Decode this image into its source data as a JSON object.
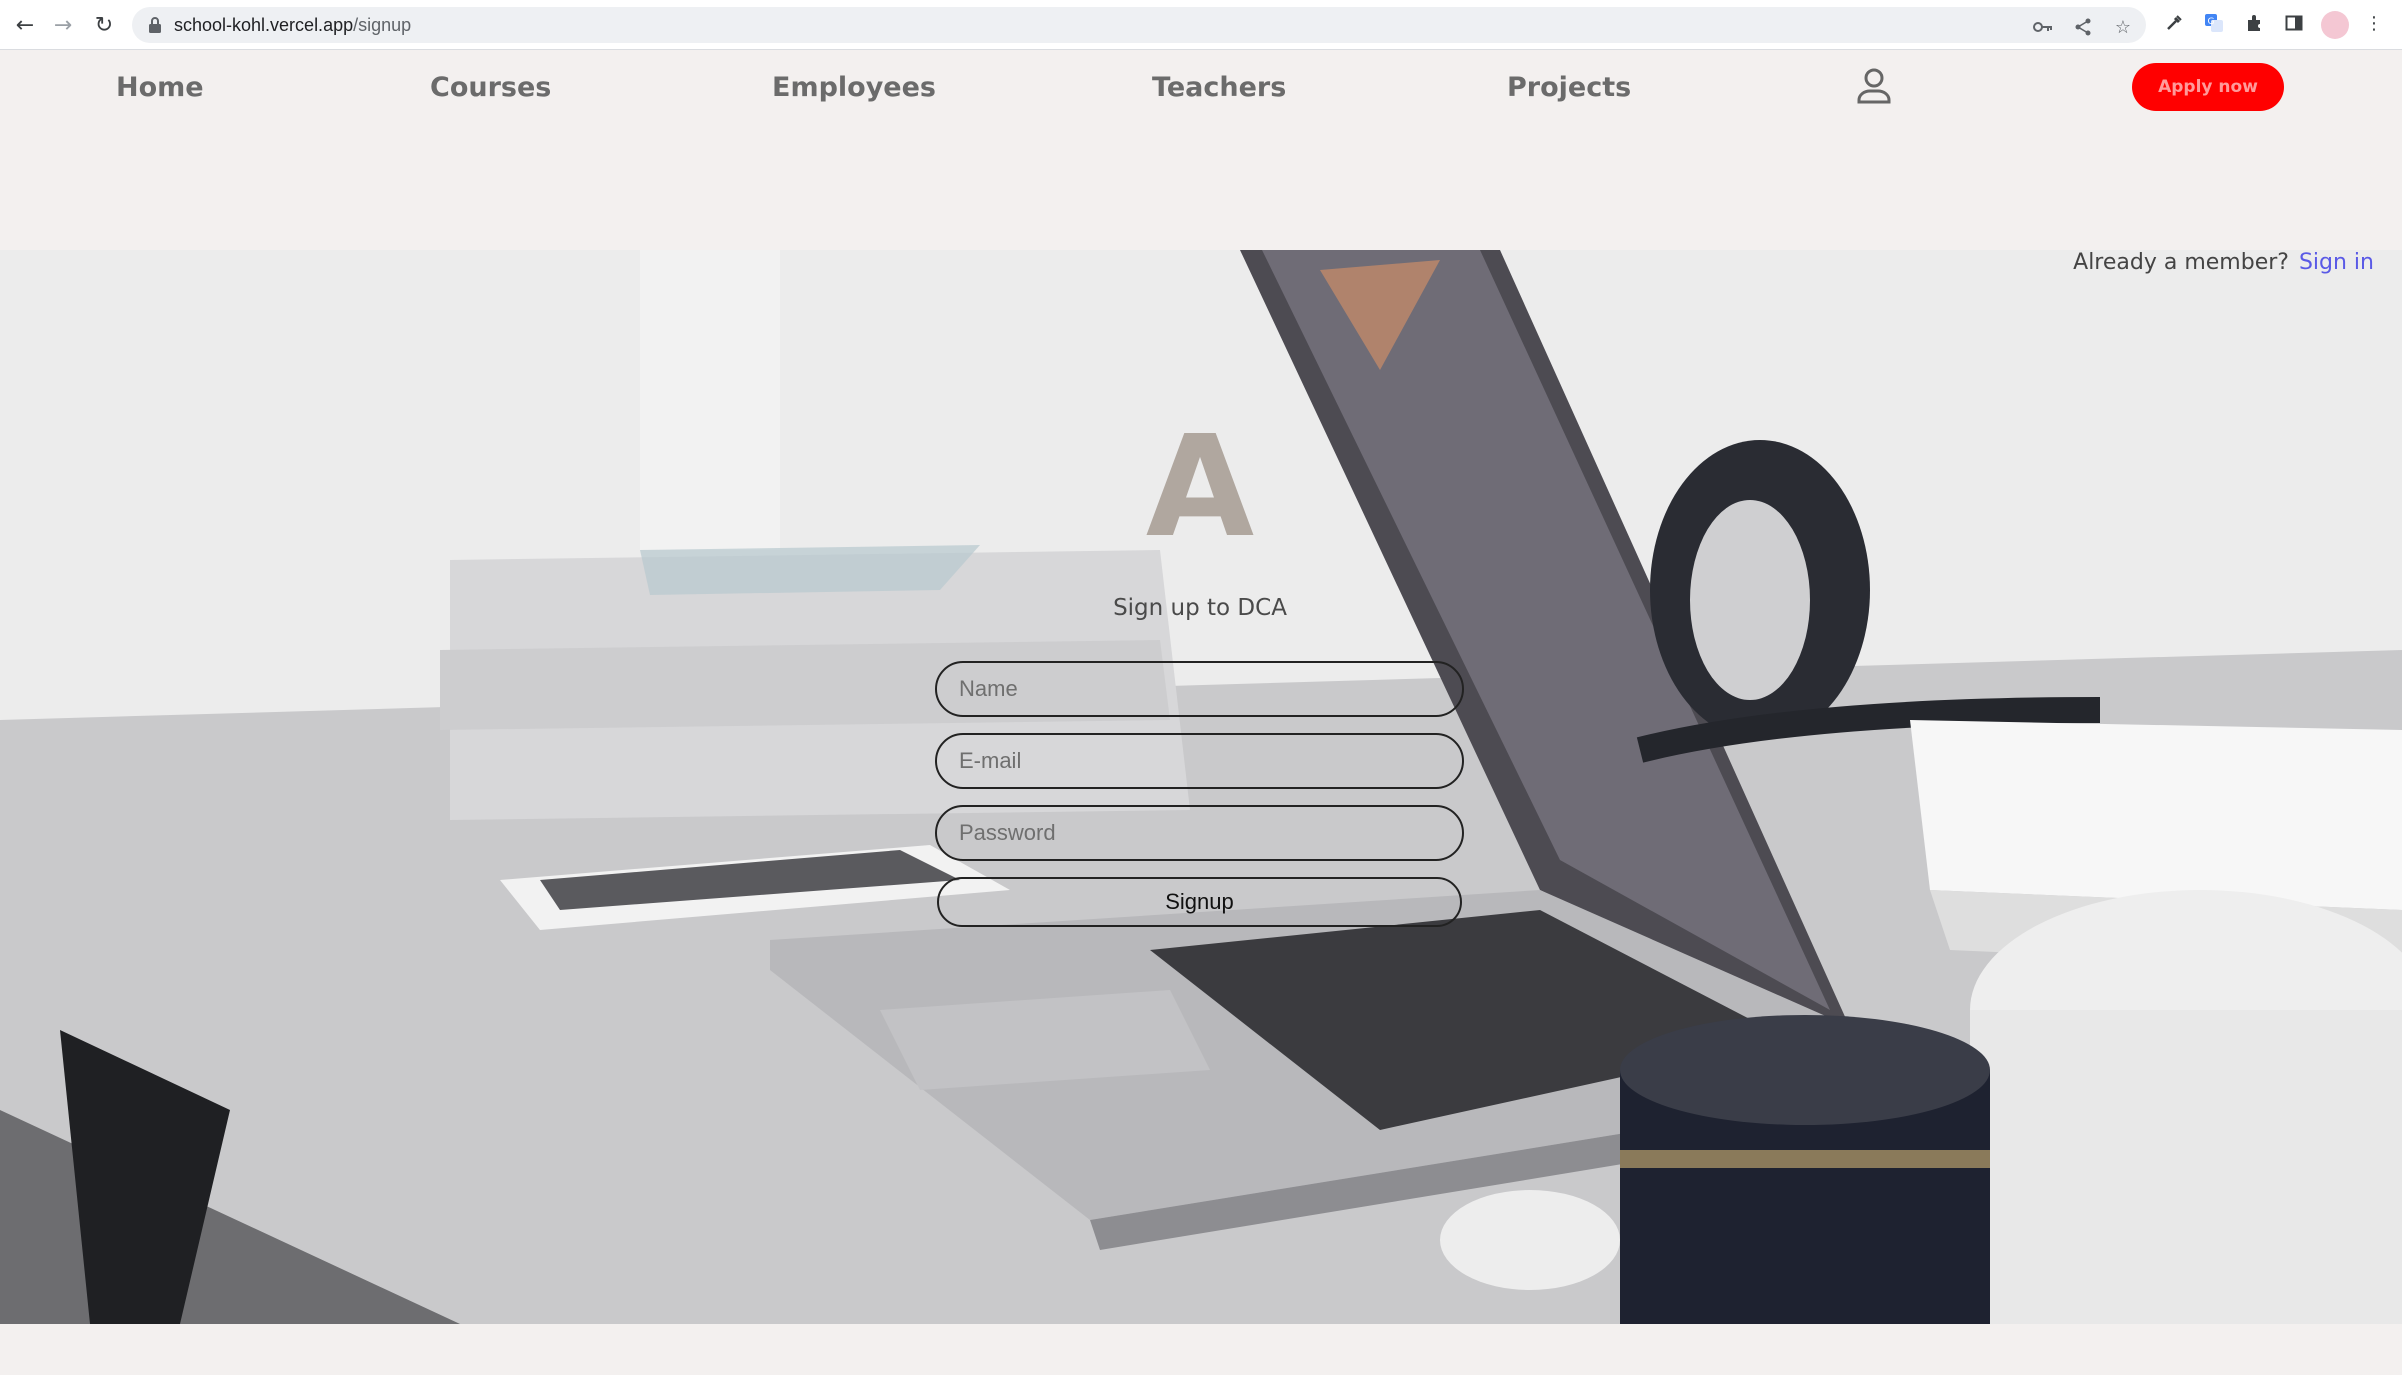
{
  "browser": {
    "url_host": "school-kohl.vercel.app",
    "url_path": "/signup"
  },
  "nav": {
    "items": [
      {
        "label": "Home"
      },
      {
        "label": "Courses"
      },
      {
        "label": "Employees"
      },
      {
        "label": "Teachers"
      },
      {
        "label": "Projects"
      }
    ],
    "account_icon": "user-icon",
    "apply_label": "Apply now"
  },
  "auth": {
    "member_text": "Already a member?",
    "signin_label": "Sign in"
  },
  "form": {
    "brand_letter": "A",
    "title": "Sign up to DCA",
    "name_placeholder": "Name",
    "email_placeholder": "E-mail",
    "password_placeholder": "Password",
    "submit_label": "Signup"
  },
  "colors": {
    "apply_bg": "#ff0000",
    "signin_link": "#5a5ae6",
    "brand_letter": "#b0a79f",
    "page_bg": "#f3f0ef"
  }
}
